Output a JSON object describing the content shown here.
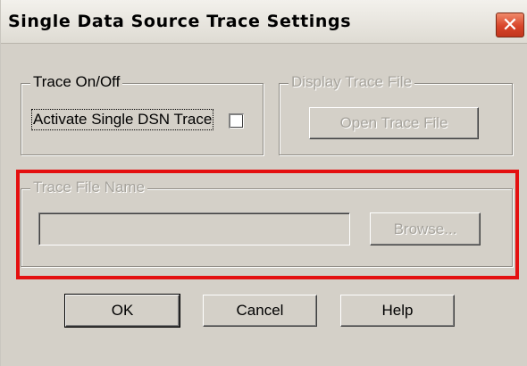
{
  "window": {
    "title": "Single Data Source Trace Settings"
  },
  "title_bar": {
    "close_glyph": "✕"
  },
  "trace_onoff": {
    "legend": "Trace On/Off",
    "checkbox_label": "Activate Single DSN Trace",
    "checked": false
  },
  "display_trace_file": {
    "legend": "Display Trace File",
    "open_button": "Open Trace File"
  },
  "trace_file_name": {
    "legend": "Trace File Name",
    "value": "",
    "browse_button": "Browse..."
  },
  "buttons": {
    "ok": "OK",
    "cancel": "Cancel",
    "help": "Help"
  },
  "colors": {
    "highlight_border": "#e41010",
    "dialog_face": "#d4d0c8",
    "disabled_text": "#a7a49d"
  }
}
